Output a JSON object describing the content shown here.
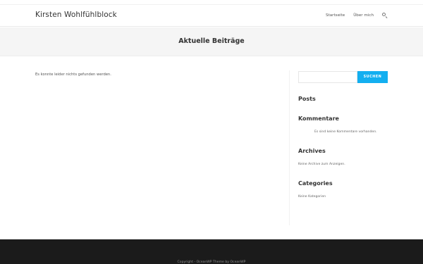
{
  "site": {
    "title": "Kirsten Wohlfühlblock"
  },
  "nav": {
    "items": [
      "Startseite",
      "Über mich"
    ]
  },
  "page": {
    "title": "Aktuelle Beiträge"
  },
  "content": {
    "message": "Es konnte leider nichts gefunden werden."
  },
  "sidebar": {
    "search": {
      "placeholder": "",
      "button_label": "SUCHEN"
    },
    "posts": {
      "title": "Posts"
    },
    "comments": {
      "title": "Kommentare",
      "text": "Es sind keine Kommentare vorhanden."
    },
    "archives": {
      "title": "Archives",
      "text": "Keine Archive zum Anzeigen."
    },
    "categories": {
      "title": "Categories",
      "text": "Keine Kategorien"
    }
  },
  "footer": {
    "copyright": "Copyright - OceanWP Theme by OceanWP"
  },
  "colors": {
    "accent": "#13aff0",
    "footer_bg": "#1b1b1b",
    "page_header_bg": "#f5f5f5"
  }
}
